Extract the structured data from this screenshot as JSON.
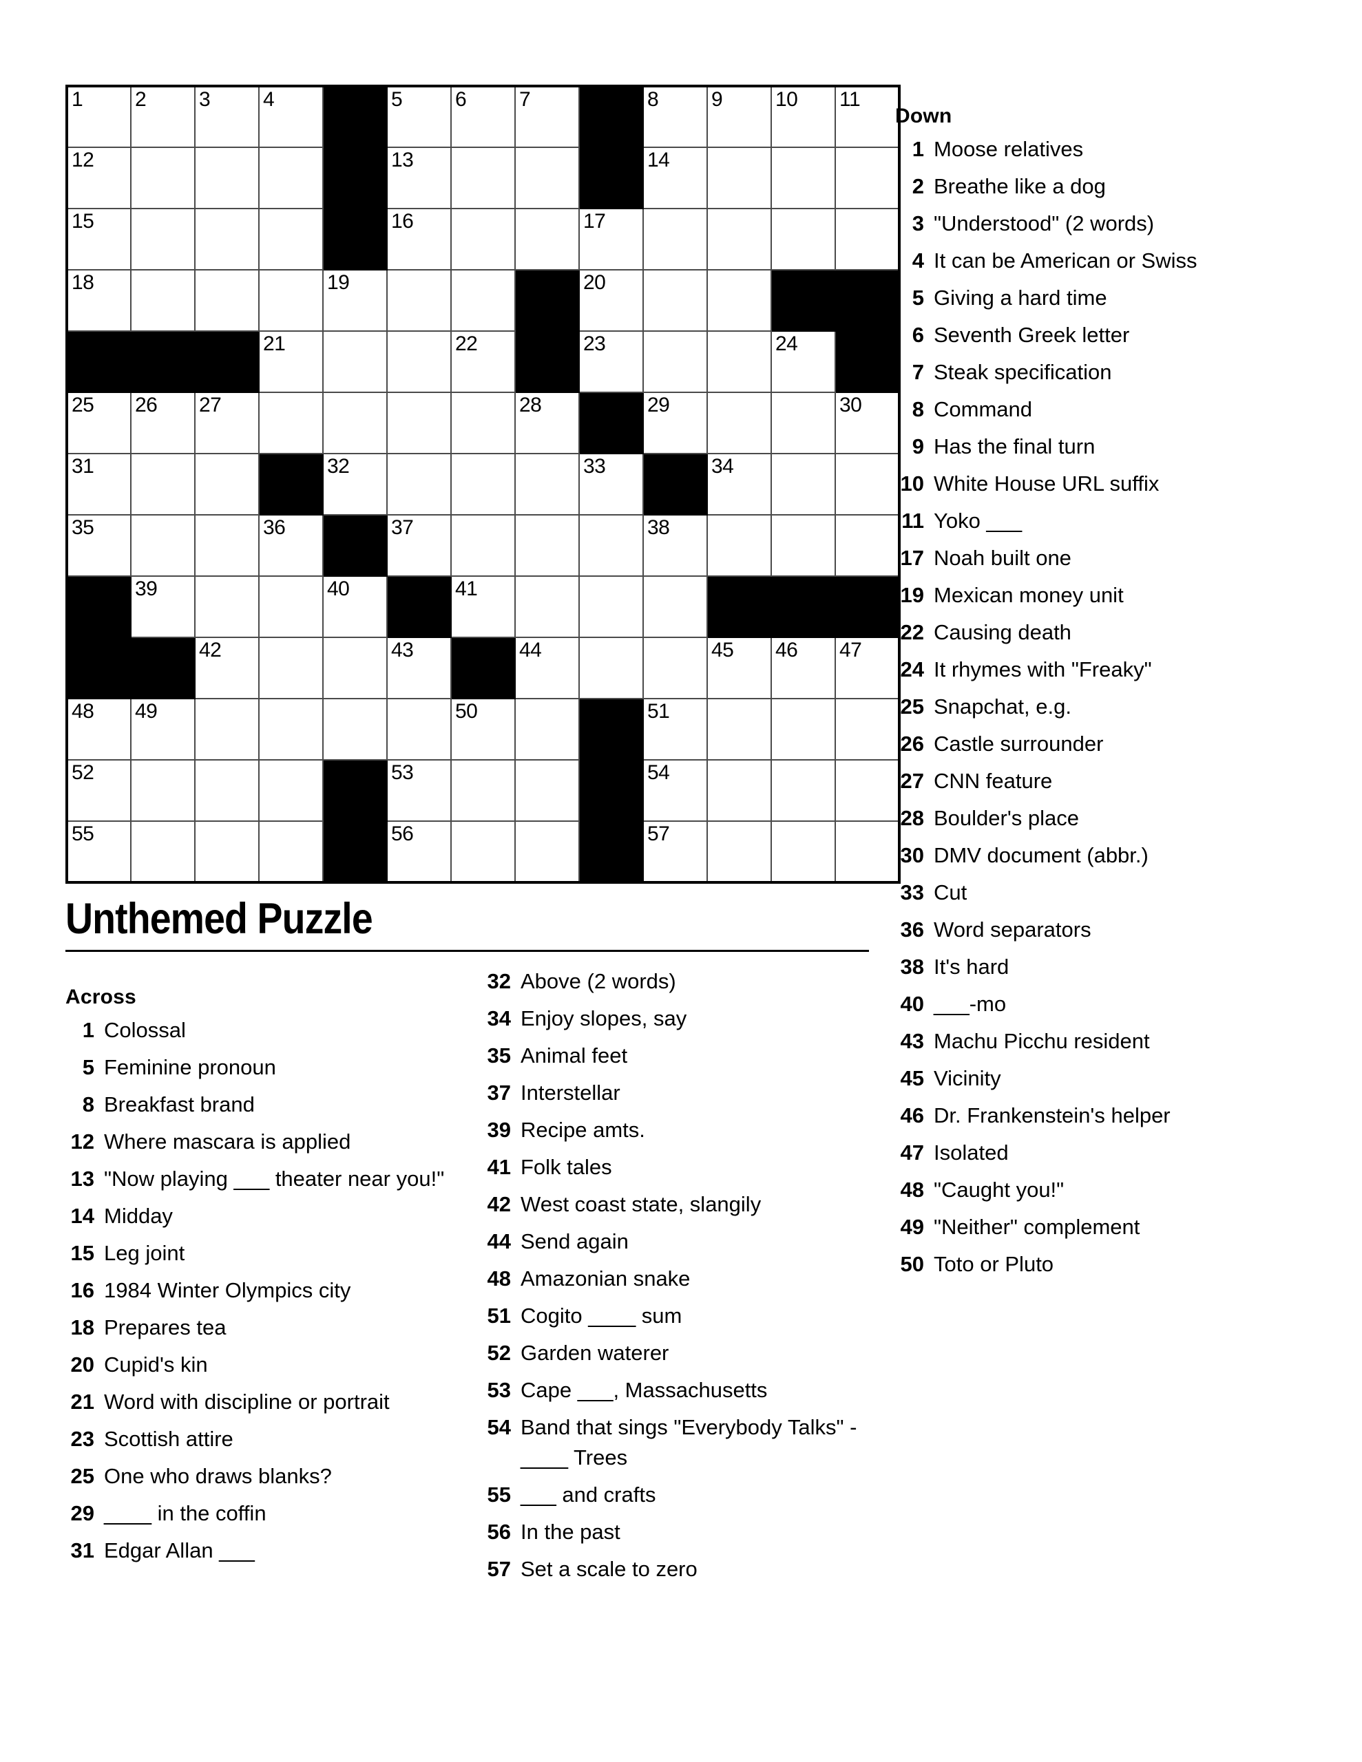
{
  "title": "Unthemed Puzzle",
  "sections": {
    "across_label": "Across",
    "down_label": "Down"
  },
  "grid": {
    "rows": 13,
    "cols": 13,
    "black_color": "#000000",
    "cell_color": "#ffffff",
    "border_color": "#4a4a4a",
    "cells": [
      [
        {
          "n": "1"
        },
        {
          "n": "2"
        },
        {
          "n": "3"
        },
        {
          "n": "4"
        },
        {
          "b": 1
        },
        {
          "n": "5"
        },
        {
          "n": "6"
        },
        {
          "n": "7"
        },
        {
          "b": 1
        },
        {
          "n": "8"
        },
        {
          "n": "9"
        },
        {
          "n": "10"
        },
        {
          "n": "11"
        }
      ],
      [
        {
          "n": "12"
        },
        {},
        {},
        {},
        {
          "b": 1
        },
        {
          "n": "13"
        },
        {},
        {},
        {
          "b": 1
        },
        {
          "n": "14"
        },
        {},
        {},
        {}
      ],
      [
        {
          "n": "15"
        },
        {},
        {},
        {},
        {
          "b": 1
        },
        {
          "n": "16"
        },
        {},
        {},
        {
          "n": "17"
        },
        {},
        {},
        {},
        {}
      ],
      [
        {
          "n": "18"
        },
        {},
        {},
        {},
        {
          "n": "19"
        },
        {},
        {},
        {
          "b": 1
        },
        {
          "n": "20"
        },
        {},
        {},
        {
          "b": 1
        },
        {
          "b": 1
        }
      ],
      [
        {
          "b": 1
        },
        {
          "b": 1
        },
        {
          "b": 1
        },
        {
          "n": "21"
        },
        {},
        {},
        {
          "n": "22"
        },
        {
          "b": 1
        },
        {
          "n": "23"
        },
        {},
        {},
        {
          "n": "24"
        },
        {
          "b": 1
        }
      ],
      [
        {
          "n": "25"
        },
        {
          "n": "26"
        },
        {
          "n": "27"
        },
        {},
        {},
        {},
        {},
        {
          "n": "28"
        },
        {
          "b": 1
        },
        {
          "n": "29"
        },
        {},
        {},
        {
          "n": "30"
        }
      ],
      [
        {
          "n": "31"
        },
        {},
        {},
        {
          "b": 1
        },
        {
          "n": "32"
        },
        {},
        {},
        {},
        {
          "n": "33"
        },
        {
          "b": 1
        },
        {
          "n": "34"
        },
        {},
        {}
      ],
      [
        {
          "n": "35"
        },
        {},
        {},
        {
          "n": "36"
        },
        {
          "b": 1
        },
        {
          "n": "37"
        },
        {},
        {},
        {},
        {
          "n": "38"
        },
        {},
        {},
        {}
      ],
      [
        {
          "b": 1
        },
        {
          "n": "39"
        },
        {},
        {},
        {
          "n": "40"
        },
        {
          "b": 1
        },
        {
          "n": "41"
        },
        {},
        {},
        {},
        {
          "b": 1
        },
        {
          "b": 1
        },
        {
          "b": 1
        }
      ],
      [
        {
          "b": 1
        },
        {
          "b": 1
        },
        {
          "n": "42"
        },
        {},
        {},
        {
          "n": "43"
        },
        {
          "b": 1
        },
        {
          "n": "44"
        },
        {},
        {},
        {
          "n": "45"
        },
        {
          "n": "46"
        },
        {
          "n": "47"
        }
      ],
      [
        {
          "n": "48"
        },
        {
          "n": "49"
        },
        {},
        {},
        {},
        {},
        {
          "n": "50"
        },
        {},
        {
          "b": 1
        },
        {
          "n": "51"
        },
        {},
        {},
        {}
      ],
      [
        {
          "n": "52"
        },
        {},
        {},
        {},
        {
          "b": 1
        },
        {
          "n": "53"
        },
        {},
        {},
        {
          "b": 1
        },
        {
          "n": "54"
        },
        {},
        {},
        {}
      ],
      [
        {
          "n": "55"
        },
        {},
        {},
        {},
        {
          "b": 1
        },
        {
          "n": "56"
        },
        {},
        {},
        {
          "b": 1
        },
        {
          "n": "57"
        },
        {},
        {},
        {}
      ]
    ]
  },
  "across_clues_col1": [
    {
      "num": "1",
      "clue": "Colossal"
    },
    {
      "num": "5",
      "clue": "Feminine pronoun"
    },
    {
      "num": "8",
      "clue": "Breakfast brand"
    },
    {
      "num": "12",
      "clue": "Where mascara is applied"
    },
    {
      "num": "13",
      "clue": "\"Now playing ___ theater near you!\""
    },
    {
      "num": "14",
      "clue": "Midday"
    },
    {
      "num": "15",
      "clue": "Leg joint"
    },
    {
      "num": "16",
      "clue": "1984 Winter Olympics city"
    },
    {
      "num": "18",
      "clue": "Prepares tea"
    },
    {
      "num": "20",
      "clue": "Cupid's kin"
    },
    {
      "num": "21",
      "clue": "Word with discipline or portrait"
    },
    {
      "num": "23",
      "clue": "Scottish attire"
    },
    {
      "num": "25",
      "clue": "One who draws blanks?"
    },
    {
      "num": "29",
      "clue": "____ in the coffin"
    },
    {
      "num": "31",
      "clue": "Edgar Allan ___"
    }
  ],
  "across_clues_col2": [
    {
      "num": "32",
      "clue": "Above (2 words)"
    },
    {
      "num": "34",
      "clue": "Enjoy slopes, say"
    },
    {
      "num": "35",
      "clue": "Animal feet"
    },
    {
      "num": "37",
      "clue": "Interstellar"
    },
    {
      "num": "39",
      "clue": "Recipe amts."
    },
    {
      "num": "41",
      "clue": "Folk tales"
    },
    {
      "num": "42",
      "clue": "West coast state, slangily"
    },
    {
      "num": "44",
      "clue": "Send again"
    },
    {
      "num": "48",
      "clue": "Amazonian snake"
    },
    {
      "num": "51",
      "clue": "Cogito ____ sum"
    },
    {
      "num": "52",
      "clue": "Garden waterer"
    },
    {
      "num": "53",
      "clue": "Cape ___, Massachusetts"
    },
    {
      "num": "54",
      "clue": "Band that sings \"Everybody Talks\" - ____ Trees"
    },
    {
      "num": "55",
      "clue": "___ and crafts"
    },
    {
      "num": "56",
      "clue": "In the past"
    },
    {
      "num": "57",
      "clue": "Set a scale to zero"
    }
  ],
  "down_clues": [
    {
      "num": "1",
      "clue": "Moose relatives"
    },
    {
      "num": "2",
      "clue": "Breathe like a dog"
    },
    {
      "num": "3",
      "clue": "\"Understood\" (2 words)"
    },
    {
      "num": "4",
      "clue": "It can be American or Swiss"
    },
    {
      "num": "5",
      "clue": "Giving a hard time"
    },
    {
      "num": "6",
      "clue": "Seventh Greek letter"
    },
    {
      "num": "7",
      "clue": "Steak specification"
    },
    {
      "num": "8",
      "clue": "Command"
    },
    {
      "num": "9",
      "clue": "Has the final turn"
    },
    {
      "num": "10",
      "clue": "White House URL suffix"
    },
    {
      "num": "11",
      "clue": "Yoko ___"
    },
    {
      "num": "17",
      "clue": "Noah built one"
    },
    {
      "num": "19",
      "clue": "Mexican money unit"
    },
    {
      "num": "22",
      "clue": "Causing death"
    },
    {
      "num": "24",
      "clue": "It rhymes with \"Freaky\""
    },
    {
      "num": "25",
      "clue": "Snapchat, e.g."
    },
    {
      "num": "26",
      "clue": "Castle surrounder"
    },
    {
      "num": "27",
      "clue": "CNN feature"
    },
    {
      "num": "28",
      "clue": "Boulder's place"
    },
    {
      "num": "30",
      "clue": "DMV document (abbr.)"
    },
    {
      "num": "33",
      "clue": "Cut"
    },
    {
      "num": "36",
      "clue": "Word separators"
    },
    {
      "num": "38",
      "clue": "It's hard"
    },
    {
      "num": "40",
      "clue": "___-mo"
    },
    {
      "num": "43",
      "clue": "Machu Picchu resident"
    },
    {
      "num": "45",
      "clue": "Vicinity"
    },
    {
      "num": "46",
      "clue": "Dr. Frankenstein's helper"
    },
    {
      "num": "47",
      "clue": "Isolated"
    },
    {
      "num": "48",
      "clue": "\"Caught you!\""
    },
    {
      "num": "49",
      "clue": "\"Neither\" complement"
    },
    {
      "num": "50",
      "clue": "Toto or Pluto"
    }
  ]
}
